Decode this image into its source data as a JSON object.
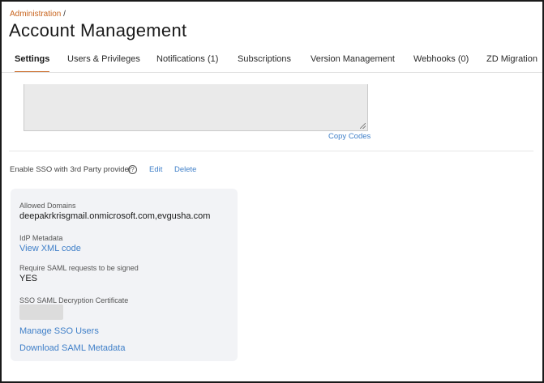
{
  "breadcrumb": {
    "parent": "Administration",
    "separator": "/"
  },
  "page_title": "Account Management",
  "tabs": [
    {
      "label": "Settings",
      "active": true
    },
    {
      "label": "Users & Privileges",
      "active": false
    },
    {
      "label": "Notifications (1)",
      "active": false
    },
    {
      "label": "Subscriptions",
      "active": false
    },
    {
      "label": "Version Management",
      "active": false
    },
    {
      "label": "Webhooks (0)",
      "active": false
    },
    {
      "label": "ZD Migration",
      "active": false
    }
  ],
  "codes": {
    "copy_label": "Copy Codes"
  },
  "sso": {
    "label": "Enable SSO with 3rd Party provider",
    "help_icon": "?",
    "edit_label": "Edit",
    "delete_label": "Delete"
  },
  "card": {
    "allowed_domains_label": "Allowed Domains",
    "allowed_domains_value": "deepakrkrisgmail.onmicrosoft.com,evgusha.com",
    "idp_metadata_label": "IdP Metadata",
    "idp_metadata_link": "View XML code",
    "require_saml_label": "Require SAML requests to be signed",
    "require_saml_value": "YES",
    "decryption_cert_label": "SSO SAML Decryption Certificate",
    "manage_users_link": "Manage SSO Users",
    "download_metadata_link": "Download SAML Metadata"
  },
  "colors": {
    "accent": "#c8641e",
    "link": "#3f7fc8",
    "card_bg": "#f2f3f6"
  }
}
